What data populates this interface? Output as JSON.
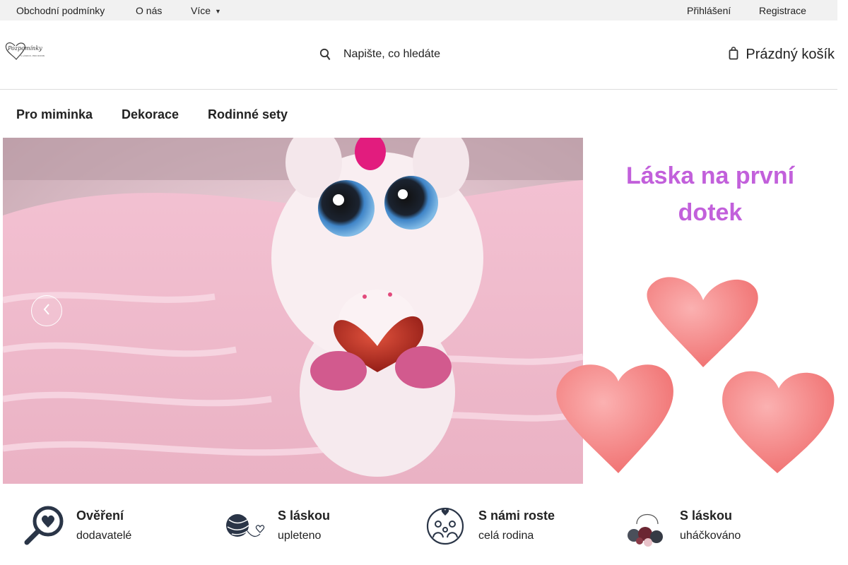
{
  "topbar": {
    "links": [
      "Obchodní podmínky",
      "O nás",
      "Více"
    ],
    "login": "Přihlášení",
    "register": "Registrace"
  },
  "header": {
    "logo_alt": "Pozpomínky",
    "search_placeholder": "Napište, co hledáte",
    "cart_label": "Prázdný košík"
  },
  "nav": {
    "items": [
      "Pro miminka",
      "Dekorace",
      "Rodinné sety"
    ]
  },
  "banner": {
    "side_title_line1": "Láska na první",
    "side_title_line2": "dotek",
    "accent_color": "#c260db"
  },
  "features": [
    {
      "title": "Ověření",
      "subtitle": "dodavatelé",
      "icon": "magnifier-heart-icon"
    },
    {
      "title": "S láskou",
      "subtitle": "upleteno",
      "icon": "yarn-ball-icon"
    },
    {
      "title": "S námi roste",
      "subtitle": "celá rodina",
      "icon": "family-icon"
    },
    {
      "title": "S láskou",
      "subtitle": "uháčkováno",
      "icon": "yarn-basket-icon"
    }
  ]
}
